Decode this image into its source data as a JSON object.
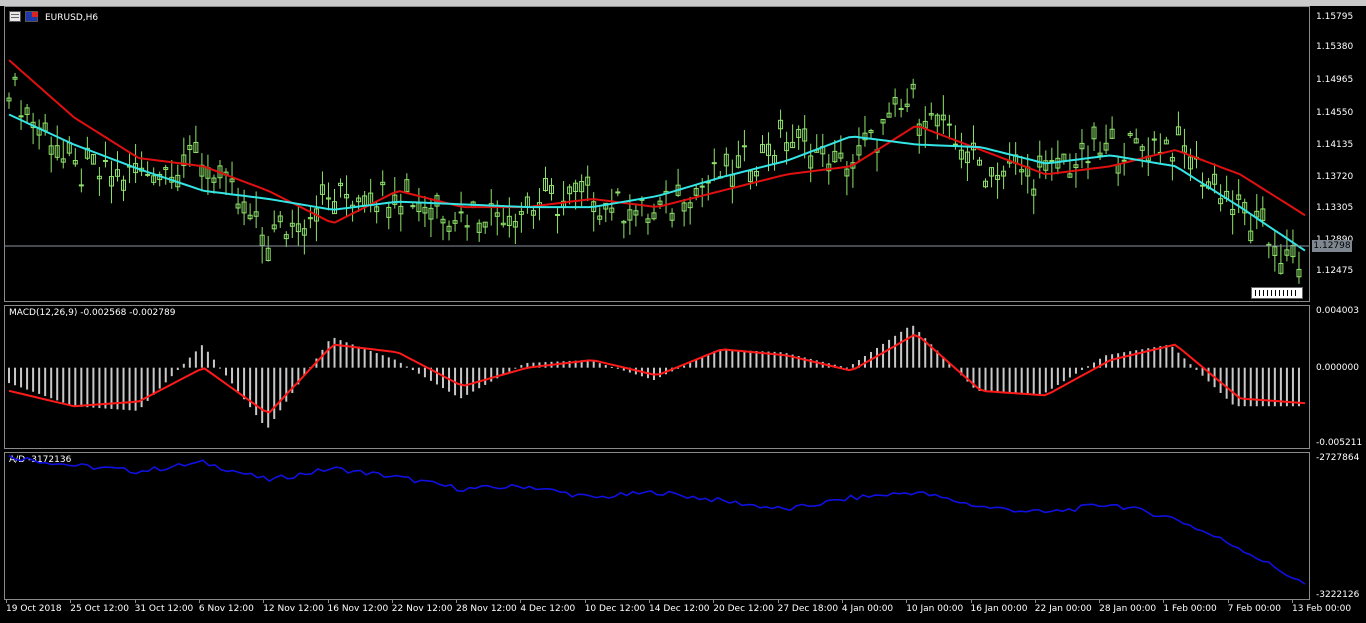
{
  "chart": {
    "symbol": "EURUSD,H6",
    "current_price_badge": "1.12798",
    "price_ticks": [
      "1.15795",
      "1.15380",
      "1.14965",
      "1.14550",
      "1.14135",
      "1.13720",
      "1.13305",
      "1.12890",
      "1.12475"
    ]
  },
  "macd": {
    "label": "MACD(12,26,9) -0.002568 -0.002789",
    "ticks": [
      "0.004003",
      "0.000000",
      "-0.005211"
    ]
  },
  "ad": {
    "label": "A/D -3172136",
    "ticks": [
      "-2727864",
      "-3222126"
    ]
  },
  "x_axis": {
    "labels": [
      "19 Oct 2018",
      "25 Oct 12:00",
      "31 Oct 12:00",
      "6 Nov 12:00",
      "12 Nov 12:00",
      "16 Nov 12:00",
      "22 Nov 12:00",
      "28 Nov 12:00",
      "4 Dec 12:00",
      "10 Dec 12:00",
      "14 Dec 12:00",
      "20 Dec 12:00",
      "27 Dec 18:00",
      "4 Jan 00:00",
      "10 Jan 00:00",
      "16 Jan 00:00",
      "22 Jan 00:00",
      "28 Jan 00:00",
      "1 Feb 00:00",
      "7 Feb 00:00",
      "13 Feb 00:00"
    ]
  },
  "colors": {
    "candle": "#8fe36b",
    "ma_fast": "#33e5e5",
    "ma_slow": "#e01010",
    "macd_hist": "#c8c8c8",
    "macd_signal": "#ff1a1a",
    "ad_line": "#1010e0",
    "current_price_line": "#8a95a0"
  },
  "chart_data": [
    {
      "type": "line",
      "title": "EURUSD,H6",
      "x": [
        "19 Oct 2018",
        "25 Oct 12:00",
        "31 Oct 12:00",
        "6 Nov 12:00",
        "12 Nov 12:00",
        "16 Nov 12:00",
        "22 Nov 12:00",
        "28 Nov 12:00",
        "4 Dec 12:00",
        "10 Dec 12:00",
        "14 Dec 12:00",
        "20 Dec 12:00",
        "27 Dec 18:00",
        "4 Jan 00:00",
        "10 Jan 00:00",
        "16 Jan 00:00",
        "22 Jan 00:00",
        "28 Jan 00:00",
        "1 Feb 00:00",
        "7 Feb 00:00",
        "13 Feb 00:00"
      ],
      "series": [
        {
          "values": [
            1.15,
            1.139,
            1.139,
            1.141,
            1.131,
            1.136,
            1.137,
            1.134,
            1.135,
            1.136,
            1.134,
            1.139,
            1.143,
            1.14,
            1.148,
            1.14,
            1.139,
            1.142,
            1.143,
            1.135,
            1.127
          ]
        },
        {
          "values": [
            1.153,
            1.146,
            1.141,
            1.14,
            1.137,
            1.133,
            1.137,
            1.135,
            1.135,
            1.136,
            1.135,
            1.137,
            1.139,
            1.14,
            1.145,
            1.142,
            1.139,
            1.14,
            1.142,
            1.139,
            1.134
          ]
        }
      ],
      "ylim": [
        1.1235,
        1.1595
      ]
    },
    {
      "type": "bar",
      "title": "MACD(12,26,9) -0.002568 -0.002789",
      "categories": [
        "19 Oct 2018",
        "25 Oct 12:00",
        "31 Oct 12:00",
        "6 Nov 12:00",
        "12 Nov 12:00",
        "16 Nov 12:00",
        "22 Nov 12:00",
        "28 Nov 12:00",
        "4 Dec 12:00",
        "10 Dec 12:00",
        "14 Dec 12:00",
        "20 Dec 12:00",
        "27 Dec 18:00",
        "4 Jan 00:00",
        "10 Jan 00:00",
        "16 Jan 00:00",
        "22 Jan 00:00",
        "28 Jan 00:00",
        "1 Feb 00:00",
        "7 Feb 00:00",
        "13 Feb 00:00"
      ],
      "values": [
        -0.001,
        -0.0025,
        -0.0028,
        0.0015,
        -0.004,
        0.002,
        0.0005,
        -0.002,
        0.0003,
        0.0005,
        -0.0008,
        0.0012,
        0.001,
        0.0,
        0.0028,
        -0.0015,
        -0.0018,
        0.0008,
        0.0015,
        -0.0025,
        -0.0025
      ],
      "signal": [
        -0.0015,
        -0.0025,
        -0.0022,
        0.0,
        -0.003,
        0.0015,
        0.001,
        -0.0012,
        0.0,
        0.0005,
        -0.0005,
        0.0012,
        0.0008,
        -0.0002,
        0.0022,
        -0.0015,
        -0.0018,
        0.0005,
        0.0015,
        -0.002,
        -0.0023
      ],
      "ylim": [
        -0.005211,
        0.004003
      ]
    },
    {
      "type": "line",
      "title": "A/D -3172136",
      "x": [
        "19 Oct 2018",
        "25 Oct 12:00",
        "31 Oct 12:00",
        "6 Nov 12:00",
        "12 Nov 12:00",
        "16 Nov 12:00",
        "22 Nov 12:00",
        "28 Nov 12:00",
        "4 Dec 12:00",
        "10 Dec 12:00",
        "14 Dec 12:00",
        "20 Dec 12:00",
        "27 Dec 18:00",
        "4 Jan 00:00",
        "10 Jan 00:00",
        "16 Jan 00:00",
        "22 Jan 00:00",
        "28 Jan 00:00",
        "1 Feb 00:00",
        "7 Feb 00:00",
        "13 Feb 00:00"
      ],
      "series": [
        {
          "values": [
            -2740000,
            -2770000,
            -2790000,
            -2760000,
            -2820000,
            -2780000,
            -2810000,
            -2850000,
            -2840000,
            -2880000,
            -2860000,
            -2890000,
            -2920000,
            -2880000,
            -2860000,
            -2910000,
            -2930000,
            -2900000,
            -2950000,
            -3050000,
            -3172136
          ]
        }
      ],
      "ylim": [
        -3222126,
        -2727864
      ]
    }
  ]
}
